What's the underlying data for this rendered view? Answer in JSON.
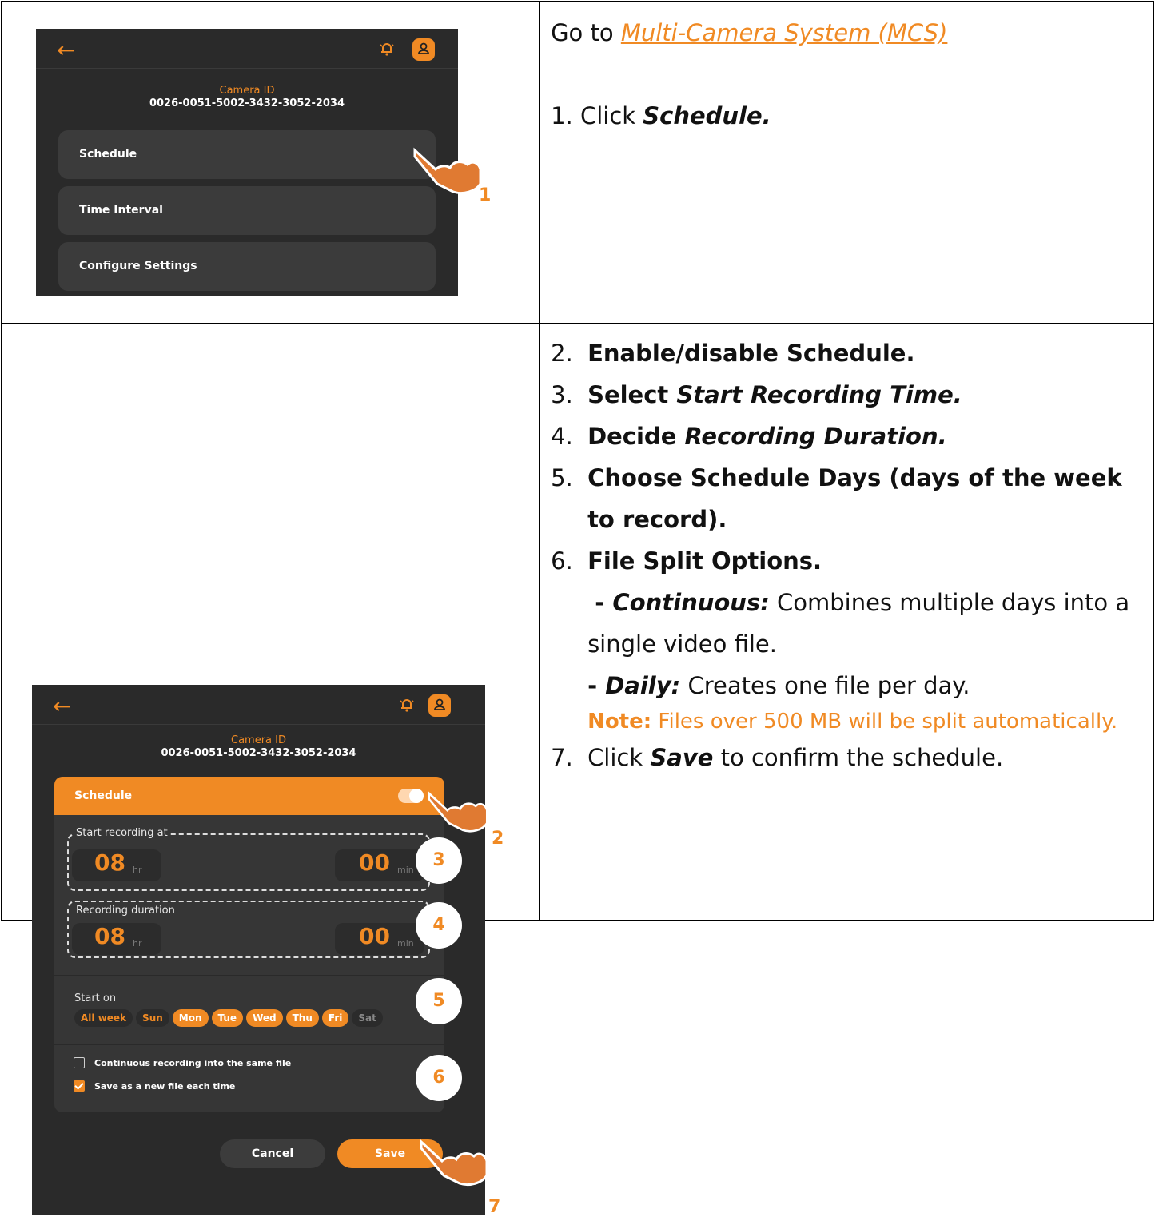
{
  "row1": {
    "instructions": {
      "goto_prefix": "Go to ",
      "goto_link": "Multi-Camera System (MCS)",
      "step1_num": "1.",
      "step1_text": "Click ",
      "step1_target": "Schedule."
    },
    "screen": {
      "camera_id_label": "Camera ID",
      "camera_id": "0026-0051-5002-3432-3052-2034",
      "menu": [
        "Schedule",
        "Time Interval",
        "Configure Settings"
      ]
    },
    "marker": "1"
  },
  "row2": {
    "instructions": {
      "s2_num": "2.",
      "s2": "Enable/disable Schedule.",
      "s3_num": "3.",
      "s3_a": "Select ",
      "s3_b": "Start Recording Time.",
      "s4_num": "4.",
      "s4_a": "Decide ",
      "s4_b": "Recording Duration.",
      "s5_num": "5.",
      "s5": "Choose Schedule Days (days of the week to record).",
      "s6_num": "6.",
      "s6": "File Split Options.",
      "cont_dash": "- ",
      "cont_label": "Continuous:",
      "cont_text": " Combines multiple days into a single video file.",
      "daily_dash": " - ",
      "daily_label": "Daily:",
      "daily_text": " Creates one file per day.",
      "note_label": "Note:",
      "note_text": " Files over 500 MB will be split automatically.",
      "s7_num": "7.",
      "s7_a": "Click ",
      "s7_b": "Save",
      "s7_c": " to confirm the schedule."
    },
    "screen": {
      "camera_id_label": "Camera ID",
      "camera_id": "0026-0051-5002-3432-3052-2034",
      "schedule_title": "Schedule",
      "schedule_enabled": true,
      "start_label": "Start recording at",
      "start_hr": "08",
      "start_min": "00",
      "duration_label": "Recording duration",
      "dur_hr": "08",
      "dur_min": "00",
      "unit_hr": "hr",
      "unit_min": "min",
      "start_on_label": "Start on",
      "days": [
        {
          "label": "All week",
          "state": "off"
        },
        {
          "label": "Sun",
          "state": "off"
        },
        {
          "label": "Mon",
          "state": "on"
        },
        {
          "label": "Tue",
          "state": "on"
        },
        {
          "label": "Wed",
          "state": "on"
        },
        {
          "label": "Thu",
          "state": "on"
        },
        {
          "label": "Fri",
          "state": "on"
        },
        {
          "label": "Sat",
          "state": "muted"
        }
      ],
      "option_continuous": "Continuous recording into the same file",
      "option_continuous_checked": false,
      "option_new_file": "Save as a new file each time",
      "option_new_file_checked": true,
      "cancel": "Cancel",
      "save": "Save"
    },
    "markers": [
      "2",
      "3",
      "4",
      "5",
      "6",
      "7"
    ]
  },
  "colors": {
    "accent": "#f08a24",
    "screen_bg": "#2a2a2a",
    "card_bg": "#363636"
  }
}
